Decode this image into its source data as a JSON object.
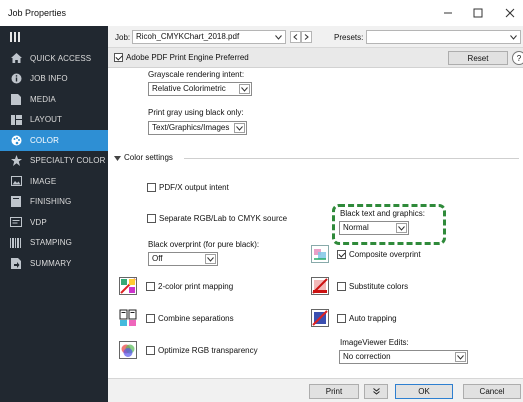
{
  "window": {
    "title": "Job Properties"
  },
  "sidebar": {
    "items": [
      {
        "label": "QUICK ACCESS"
      },
      {
        "label": "JOB INFO"
      },
      {
        "label": "MEDIA"
      },
      {
        "label": "LAYOUT"
      },
      {
        "label": "COLOR"
      },
      {
        "label": "SPECIALTY COLOR"
      },
      {
        "label": "IMAGE"
      },
      {
        "label": "FINISHING"
      },
      {
        "label": "VDP"
      },
      {
        "label": "STAMPING"
      },
      {
        "label": "SUMMARY"
      }
    ],
    "active_index": 4
  },
  "toolbar": {
    "job_label": "Job:",
    "job_value": "Ricoh_CMYKChart_2018.pdf",
    "presets_label": "Presets:",
    "presets_value": ""
  },
  "engine": {
    "label": "Adobe PDF Print Engine Preferred",
    "checked": true,
    "reset_label": "Reset"
  },
  "content": {
    "grayscale_label": "Grayscale rendering intent:",
    "grayscale_value": "Relative Colorimetric",
    "printgray_label": "Print gray using black only:",
    "printgray_value": "Text/Graphics/Images",
    "section_title": "Color settings",
    "pdfx_label": "PDF/X output intent",
    "separate_label": "Separate RGB/Lab to CMYK source",
    "black_text_label": "Black text and graphics:",
    "black_text_value": "Normal",
    "black_overprint_label": "Black overprint (for pure black):",
    "black_overprint_value": "Off",
    "composite_label": "Composite overprint",
    "composite_checked": true,
    "two_color_label": "2-color print mapping",
    "substitute_label": "Substitute colors",
    "combine_label": "Combine separations",
    "auto_trapping_label": "Auto trapping",
    "optimize_label": "Optimize RGB transparency",
    "imageviewer_label": "ImageViewer Edits:",
    "imageviewer_value": "No correction"
  },
  "bottom": {
    "print_label": "Print",
    "ok_label": "OK",
    "cancel_label": "Cancel"
  },
  "colors": {
    "sidebar_bg": "#212830",
    "active_bg": "#2e8fd4",
    "highlight_dash": "#2f8a3a"
  }
}
